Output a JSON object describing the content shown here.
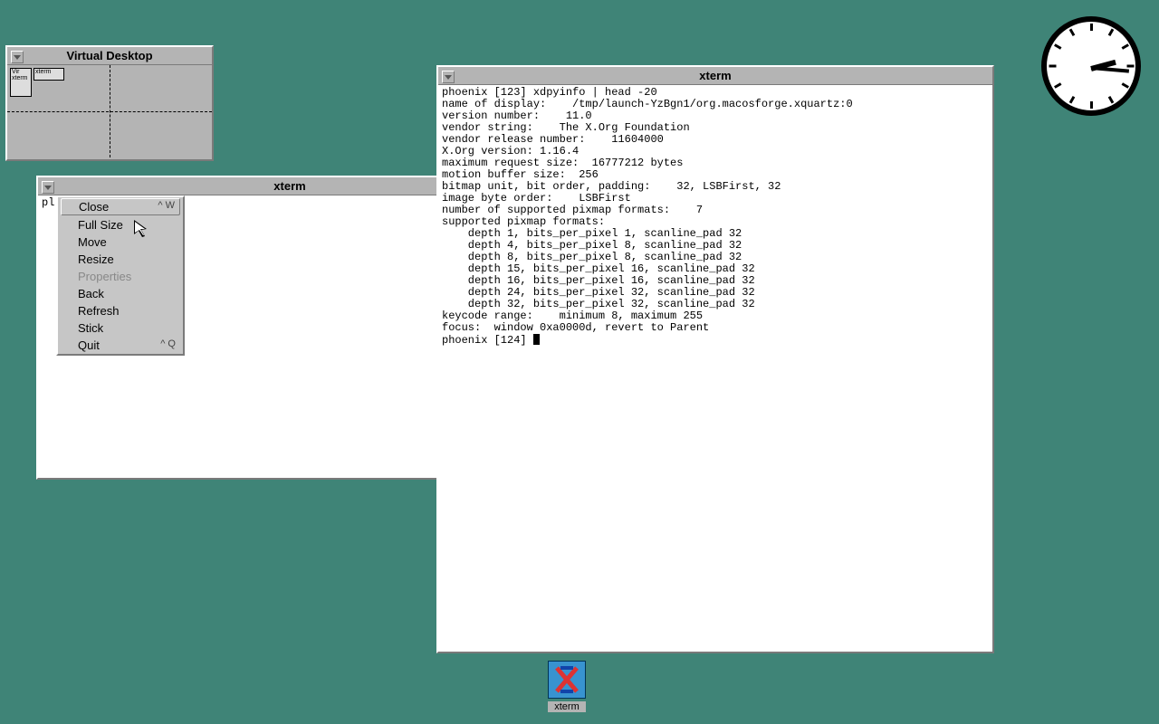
{
  "pager": {
    "title": "Virtual Desktop",
    "mini_windows": [
      {
        "label": "Vir"
      },
      {
        "label": "xterm"
      },
      {
        "label": "xterm"
      }
    ]
  },
  "xterm_left": {
    "title": "xterm",
    "visible_prefix": "pl"
  },
  "xterm_right": {
    "title": "xterm",
    "lines": [
      "phoenix [123] xdpyinfo | head -20",
      "name of display:    /tmp/launch-YzBgn1/org.macosforge.xquartz:0",
      "version number:    11.0",
      "vendor string:    The X.Org Foundation",
      "vendor release number:    11604000",
      "X.Org version: 1.16.4",
      "maximum request size:  16777212 bytes",
      "motion buffer size:  256",
      "bitmap unit, bit order, padding:    32, LSBFirst, 32",
      "image byte order:    LSBFirst",
      "number of supported pixmap formats:    7",
      "supported pixmap formats:",
      "    depth 1, bits_per_pixel 1, scanline_pad 32",
      "    depth 4, bits_per_pixel 8, scanline_pad 32",
      "    depth 8, bits_per_pixel 8, scanline_pad 32",
      "    depth 15, bits_per_pixel 16, scanline_pad 32",
      "    depth 16, bits_per_pixel 16, scanline_pad 32",
      "    depth 24, bits_per_pixel 32, scanline_pad 32",
      "    depth 32, bits_per_pixel 32, scanline_pad 32",
      "keycode range:    minimum 8, maximum 255",
      "focus:  window 0xa0000d, revert to Parent"
    ],
    "prompt": "phoenix [124] "
  },
  "context_menu": {
    "items": [
      {
        "label": "Close",
        "shortcut": "^ W",
        "selected": true,
        "disabled": false
      },
      {
        "label": "Full Size",
        "shortcut": "",
        "selected": false,
        "disabled": false
      },
      {
        "label": "Move",
        "shortcut": "",
        "selected": false,
        "disabled": false
      },
      {
        "label": "Resize",
        "shortcut": "",
        "selected": false,
        "disabled": false
      },
      {
        "label": "Properties",
        "shortcut": "",
        "selected": false,
        "disabled": true
      },
      {
        "label": "Back",
        "shortcut": "",
        "selected": false,
        "disabled": false
      },
      {
        "label": "Refresh",
        "shortcut": "",
        "selected": false,
        "disabled": false
      },
      {
        "label": "Stick",
        "shortcut": "",
        "selected": false,
        "disabled": false
      },
      {
        "label": "Quit",
        "shortcut": "^ Q",
        "selected": false,
        "disabled": false
      }
    ]
  },
  "icon": {
    "label": "xterm"
  },
  "clock": {
    "hour_angle_deg": 75,
    "minute_angle_deg": 95
  }
}
